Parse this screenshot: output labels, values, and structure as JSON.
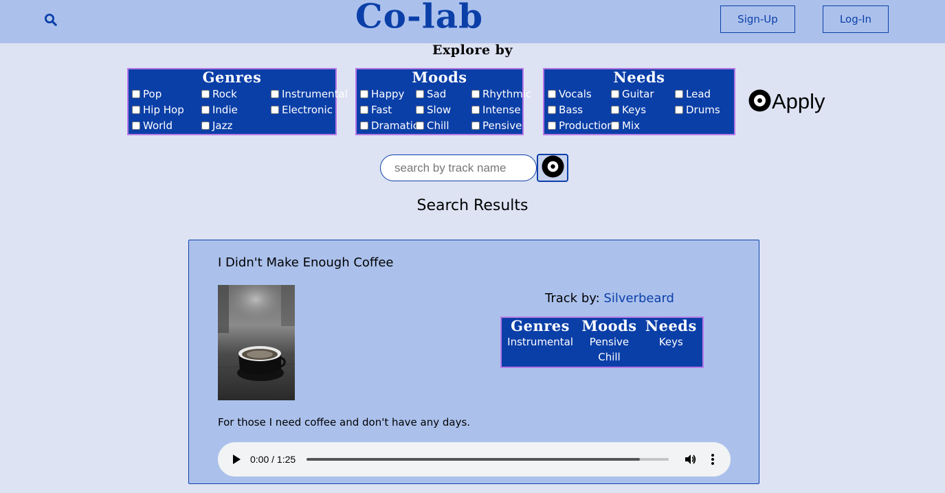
{
  "header": {
    "logo": "Co-lab",
    "signup_label": "Sign-Up",
    "login_label": "Log-In",
    "search_icon": "search-icon"
  },
  "explore": {
    "title": "Explore by",
    "genres": {
      "title": "Genres",
      "options": [
        "Pop",
        "Rock",
        "Instrumental",
        "Hip Hop",
        "Indie",
        "Electronic",
        "World",
        "Jazz"
      ]
    },
    "moods": {
      "title": "Moods",
      "options": [
        "Happy",
        "Sad",
        "Rhythmic",
        "Fast",
        "Slow",
        "Intense",
        "Dramatic",
        "Chill",
        "Pensive"
      ]
    },
    "needs": {
      "title": "Needs",
      "options": [
        "Vocals",
        "Guitar",
        "Lead",
        "Bass",
        "Keys",
        "Drums",
        "Production",
        "Mix"
      ]
    },
    "apply_label": "Apply",
    "apply_icon": "vinyl-record-icon"
  },
  "search": {
    "placeholder": "search by track name",
    "button_icon": "vinyl-record-icon"
  },
  "results": {
    "title": "Search Results",
    "track": {
      "title": "I Didn't Make Enough Coffee",
      "track_by_label": "Track by:",
      "artist": "Silverbeard",
      "cover_image": "coffee-cup-photo",
      "tags": {
        "genres_label": "Genres",
        "genres": [
          "Instrumental"
        ],
        "moods_label": "Moods",
        "moods": [
          "Pensive",
          "Chill"
        ],
        "needs_label": "Needs",
        "needs": [
          "Keys"
        ]
      },
      "description": "For those I need coffee and don't have any days.",
      "player": {
        "time": "0:00 / 1:25",
        "progress_fraction": 0.92
      }
    }
  },
  "colors": {
    "brand_blue": "#0b3fa8",
    "header_bg": "#abc1ec",
    "page_bg": "#dde3f3",
    "box_border": "#b779e6"
  }
}
